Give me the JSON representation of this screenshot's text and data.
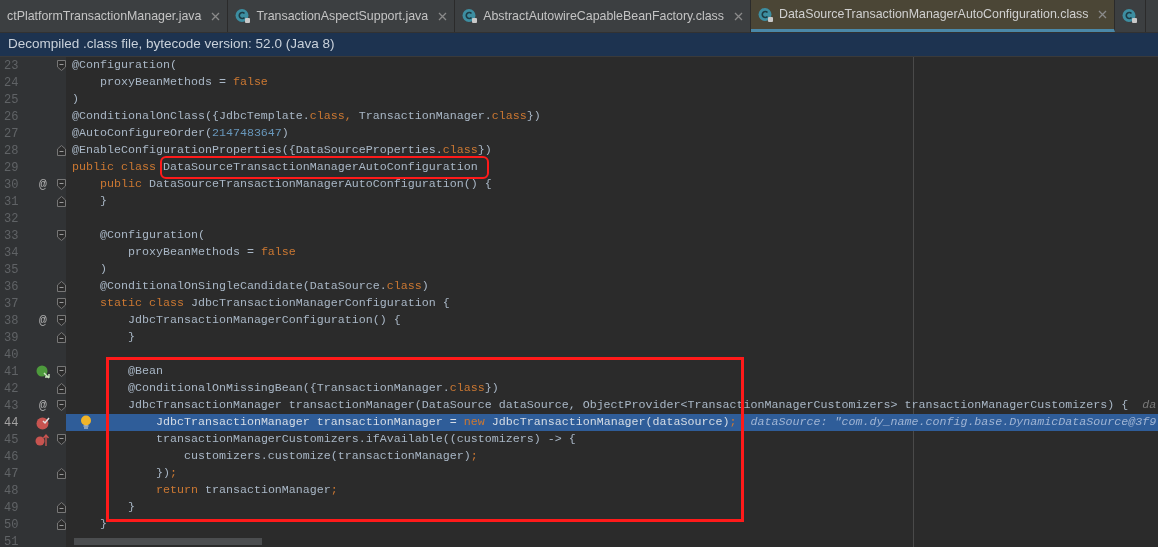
{
  "tabs": [
    {
      "label": "ctPlatformTransactionManager.java",
      "icon": false,
      "selected": false
    },
    {
      "label": "TransactionAspectSupport.java",
      "icon": true,
      "selected": false
    },
    {
      "label": "AbstractAutowireCapableBeanFactory.class",
      "icon": true,
      "selected": false
    },
    {
      "label": "DataSourceTransactionManagerAutoConfiguration.class",
      "icon": true,
      "selected": true
    },
    {
      "icon": true,
      "selected": false
    }
  ],
  "banner": "Decompiled .class file, bytecode version: 52.0 (Java 8)",
  "lines": [
    {
      "number": "23",
      "fold": {
        "kind": "open"
      },
      "tokens": [
        {
          "text": "@Configuration(",
          "kind": "plain"
        }
      ]
    },
    {
      "number": "24",
      "tokens": [
        {
          "text": "    proxyBeanMethods = ",
          "kind": "plain"
        },
        {
          "text": "false",
          "kind": "keyword"
        }
      ]
    },
    {
      "number": "25",
      "tokens": [
        {
          "text": ")",
          "kind": "plain"
        }
      ]
    },
    {
      "number": "26",
      "tokens": [
        {
          "text": "@ConditionalOnClass({JdbcTemplate.",
          "kind": "plain"
        },
        {
          "text": "class,",
          "kind": "keyword"
        },
        {
          "text": " TransactionManager.",
          "kind": "plain"
        },
        {
          "text": "class",
          "kind": "keyword"
        },
        {
          "text": "})",
          "kind": "plain"
        }
      ]
    },
    {
      "number": "27",
      "tokens": [
        {
          "text": "@AutoConfigureOrder(",
          "kind": "plain"
        },
        {
          "text": "2147483647",
          "kind": "number"
        },
        {
          "text": ")",
          "kind": "plain"
        }
      ]
    },
    {
      "number": "28",
      "fold": {
        "kind": "close"
      },
      "tokens": [
        {
          "text": "@EnableConfigurationProperties({DataSourceProperties.",
          "kind": "plain"
        },
        {
          "text": "class",
          "kind": "keyword"
        },
        {
          "text": "})",
          "kind": "plain"
        }
      ]
    },
    {
      "number": "29",
      "tokens": [
        {
          "text": "public class ",
          "kind": "keyword"
        },
        {
          "text": "DataSourceTransactionManagerAutoConfiguration",
          "kind": "plain",
          "boxed": true
        }
      ]
    },
    {
      "number": "30",
      "gutter": {
        "kind": "text",
        "text": "@"
      },
      "fold": {
        "kind": "open"
      },
      "tokens": [
        {
          "text": "    public ",
          "kind": "keyword"
        },
        {
          "text": "DataSourceTransactionManagerAutoConfiguration() {",
          "kind": "plain"
        }
      ]
    },
    {
      "number": "31",
      "fold": {
        "kind": "close"
      },
      "tokens": [
        {
          "text": "    }",
          "kind": "plain"
        }
      ]
    },
    {
      "number": "32"
    },
    {
      "number": "33",
      "fold": {
        "kind": "open"
      },
      "tokens": [
        {
          "text": "    @Configuration(",
          "kind": "plain"
        }
      ]
    },
    {
      "number": "34",
      "tokens": [
        {
          "text": "        proxyBeanMethods = ",
          "kind": "plain"
        },
        {
          "text": "false",
          "kind": "keyword"
        }
      ]
    },
    {
      "number": "35",
      "tokens": [
        {
          "text": "    )",
          "kind": "plain"
        }
      ]
    },
    {
      "number": "36",
      "fold": {
        "kind": "close"
      },
      "tokens": [
        {
          "text": "    @ConditionalOnSingleCandidate(DataSource.",
          "kind": "plain"
        },
        {
          "text": "class",
          "kind": "keyword"
        },
        {
          "text": ")",
          "kind": "plain"
        }
      ]
    },
    {
      "number": "37",
      "fold": {
        "kind": "open"
      },
      "tokens": [
        {
          "text": "    static class ",
          "kind": "keyword"
        },
        {
          "text": "JdbcTransactionManagerConfiguration {",
          "kind": "plain"
        }
      ]
    },
    {
      "number": "38",
      "gutter": {
        "kind": "text",
        "text": "@"
      },
      "fold": {
        "kind": "open"
      },
      "tokens": [
        {
          "text": "        JdbcTransactionManagerConfiguration() {",
          "kind": "plain"
        }
      ]
    },
    {
      "number": "39",
      "fold": {
        "kind": "close"
      },
      "tokens": [
        {
          "text": "        }",
          "kind": "plain"
        }
      ]
    },
    {
      "number": "40"
    },
    {
      "number": "41",
      "gutter": {
        "kind": "bean"
      },
      "fold": {
        "kind": "open"
      },
      "in_box": true,
      "tokens": [
        {
          "text": "        @Bean",
          "kind": "plain"
        }
      ]
    },
    {
      "number": "42",
      "fold": {
        "kind": "close"
      },
      "in_box": true,
      "tokens": [
        {
          "text": "        @ConditionalOnMissingBean({TransactionManager.",
          "kind": "plain"
        },
        {
          "text": "class",
          "kind": "keyword"
        },
        {
          "text": "})",
          "kind": "plain"
        }
      ]
    },
    {
      "number": "43",
      "gutter": {
        "kind": "text",
        "text": "@"
      },
      "fold": {
        "kind": "open"
      },
      "in_box": true,
      "tokens": [
        {
          "text": "        JdbcTransactionManager transactionManager(DataSource dataSource, ObjectProvider<TransactionManagerCustomizers> transactionManagerCustomizers) {",
          "kind": "plain"
        },
        {
          "text": "  da",
          "kind": "hint"
        }
      ]
    },
    {
      "number": "44",
      "gutter": {
        "kind": "breakpoint"
      },
      "current": true,
      "bulb": true,
      "in_box": true,
      "tokens": [
        {
          "text": "            JdbcTransactionManager transactionManager = ",
          "kind": "plain"
        },
        {
          "text": "new ",
          "kind": "keyword"
        },
        {
          "text": "JdbcTransactionManager(dataSource)",
          "kind": "plain"
        },
        {
          "text": ";",
          "kind": "keyword"
        },
        {
          "text": "  dataSource: \"com.dy_name.config.base.DynamicDataSource@3f9",
          "kind": "hint"
        }
      ]
    },
    {
      "number": "45",
      "gutter": {
        "kind": "lambda_breakpoint"
      },
      "fold": {
        "kind": "open"
      },
      "in_box": true,
      "tokens": [
        {
          "text": "            transactionManagerCustomizers.ifAvailable((customizers) -> {",
          "kind": "plain"
        }
      ]
    },
    {
      "number": "46",
      "in_box": true,
      "tokens": [
        {
          "text": "                customizers.customize(transactionManager)",
          "kind": "plain"
        },
        {
          "text": ";",
          "kind": "keyword"
        }
      ]
    },
    {
      "number": "47",
      "fold": {
        "kind": "close"
      },
      "in_box": true,
      "tokens": [
        {
          "text": "            })",
          "kind": "plain"
        },
        {
          "text": ";",
          "kind": "keyword"
        }
      ]
    },
    {
      "number": "48",
      "in_box": true,
      "tokens": [
        {
          "text": "            return ",
          "kind": "keyword"
        },
        {
          "text": "transactionManager",
          "kind": "plain"
        },
        {
          "text": ";",
          "kind": "keyword"
        }
      ]
    },
    {
      "number": "49",
      "fold": {
        "kind": "close"
      },
      "in_box": true,
      "tokens": [
        {
          "text": "        }",
          "kind": "plain"
        }
      ]
    },
    {
      "number": "50",
      "fold": {
        "kind": "close"
      },
      "tokens": [
        {
          "text": "    }",
          "kind": "plain"
        }
      ]
    },
    {
      "number": "51"
    }
  ]
}
